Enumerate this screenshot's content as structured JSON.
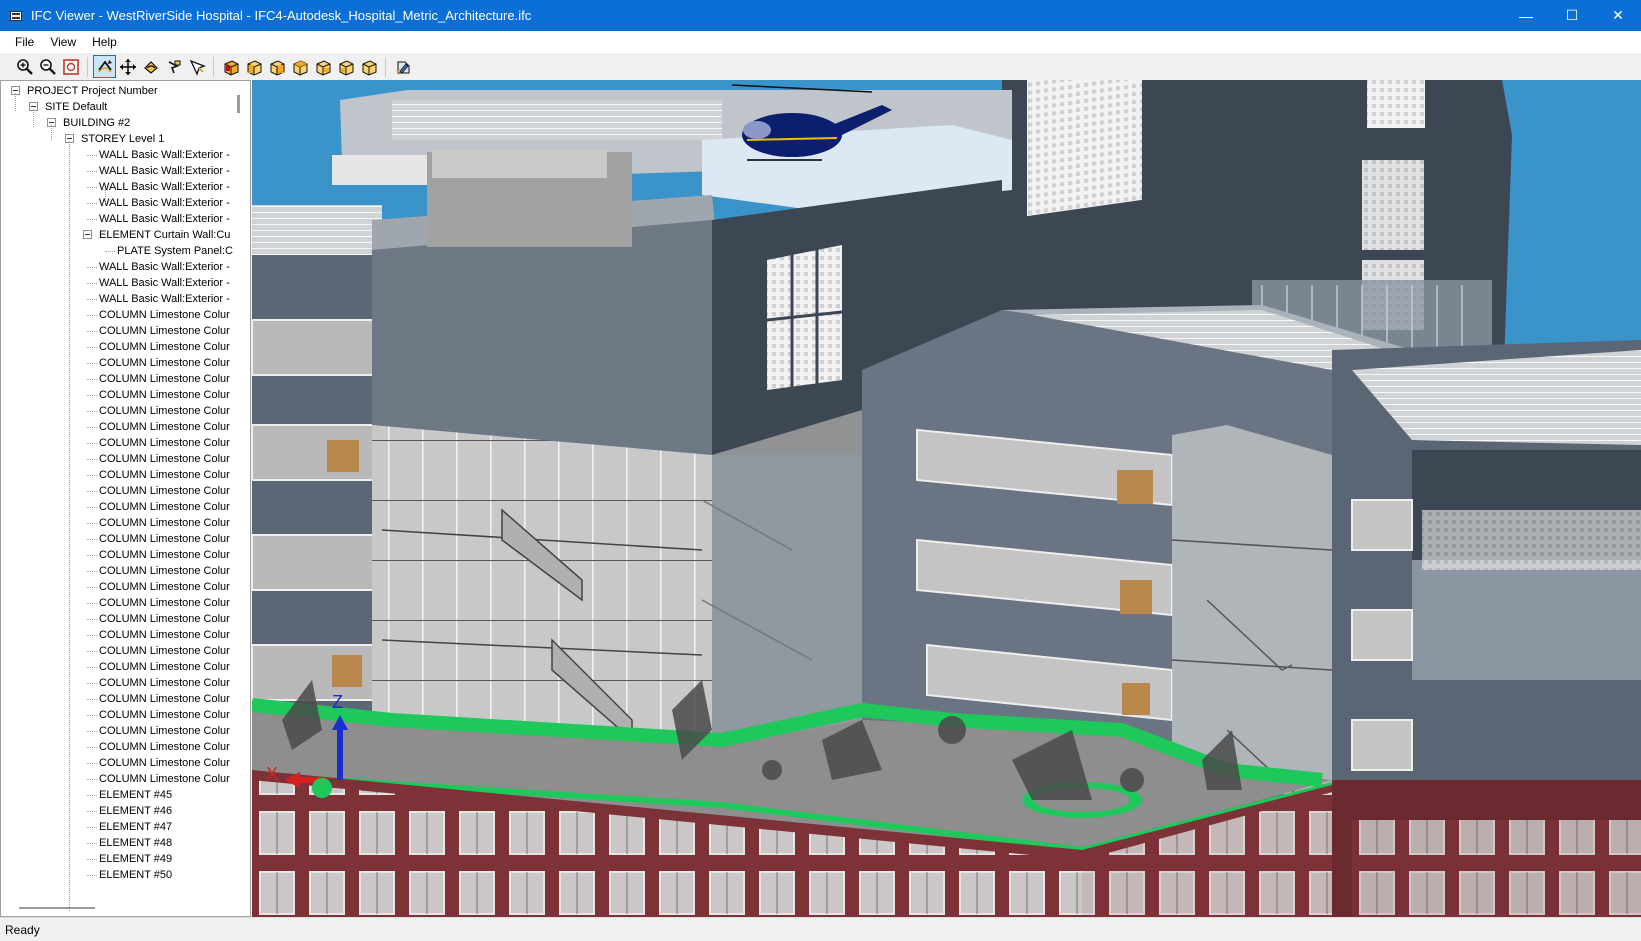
{
  "window": {
    "title": "IFC Viewer - WestRiverSide Hospital - IFC4-Autodesk_Hospital_Metric_Architecture.ifc",
    "minimize_glyph": "—",
    "maximize_glyph": "☐",
    "close_glyph": "✕"
  },
  "menu": {
    "items": [
      "File",
      "View",
      "Help"
    ]
  },
  "toolbar": {
    "buttons": [
      {
        "icon": "zoom-in-icon"
      },
      {
        "icon": "zoom-out-icon"
      },
      {
        "icon": "zoom-extents-icon"
      },
      {
        "icon": "rotate-icon",
        "active": true
      },
      {
        "icon": "pan-icon"
      },
      {
        "icon": "orbit-icon"
      },
      {
        "icon": "walk-icon"
      },
      {
        "icon": "select-icon"
      },
      {
        "icon": "view-iso-icon"
      },
      {
        "icon": "view-front-icon"
      },
      {
        "icon": "view-back-icon"
      },
      {
        "icon": "view-left-icon"
      },
      {
        "icon": "view-right-icon"
      },
      {
        "icon": "view-top-icon"
      },
      {
        "icon": "view-bottom-icon"
      },
      {
        "icon": "settings-icon"
      }
    ]
  },
  "tree": {
    "project": "PROJECT Project Number",
    "site": "SITE Default",
    "building": "BUILDING #2",
    "storey": "STOREY Level 1",
    "items": [
      "WALL Basic Wall:Exterior -",
      "WALL Basic Wall:Exterior -",
      "WALL Basic Wall:Exterior -",
      "WALL Basic Wall:Exterior -",
      "WALL Basic Wall:Exterior -",
      "ELEMENT Curtain Wall:Cu",
      "PLATE System Panel:C",
      "WALL Basic Wall:Exterior -",
      "WALL Basic Wall:Exterior -",
      "WALL Basic Wall:Exterior -",
      "COLUMN Limestone Colur",
      "COLUMN Limestone Colur",
      "COLUMN Limestone Colur",
      "COLUMN Limestone Colur",
      "COLUMN Limestone Colur",
      "COLUMN Limestone Colur",
      "COLUMN Limestone Colur",
      "COLUMN Limestone Colur",
      "COLUMN Limestone Colur",
      "COLUMN Limestone Colur",
      "COLUMN Limestone Colur",
      "COLUMN Limestone Colur",
      "COLUMN Limestone Colur",
      "COLUMN Limestone Colur",
      "COLUMN Limestone Colur",
      "COLUMN Limestone Colur",
      "COLUMN Limestone Colur",
      "COLUMN Limestone Colur",
      "COLUMN Limestone Colur",
      "COLUMN Limestone Colur",
      "COLUMN Limestone Colur",
      "COLUMN Limestone Colur",
      "COLUMN Limestone Colur",
      "COLUMN Limestone Colur",
      "COLUMN Limestone Colur",
      "COLUMN Limestone Colur",
      "COLUMN Limestone Colur",
      "COLUMN Limestone Colur",
      "COLUMN Limestone Colur",
      "COLUMN Limestone Colur",
      "ELEMENT #45",
      "ELEMENT #46",
      "ELEMENT #47",
      "ELEMENT #48",
      "ELEMENT #49",
      "ELEMENT #50"
    ]
  },
  "viewport": {
    "axis_labels": {
      "x": "X",
      "z": "Z"
    },
    "colors": {
      "sky": "#3a93c9",
      "facade_dark": "#3d4653",
      "facade_mid": "#6a7482",
      "concrete": "#9c9c9c",
      "green_roof": "#1ec85a",
      "brick": "#8b3a3f",
      "helicopter": "#0c1f6e"
    }
  },
  "status": {
    "text": "Ready"
  }
}
